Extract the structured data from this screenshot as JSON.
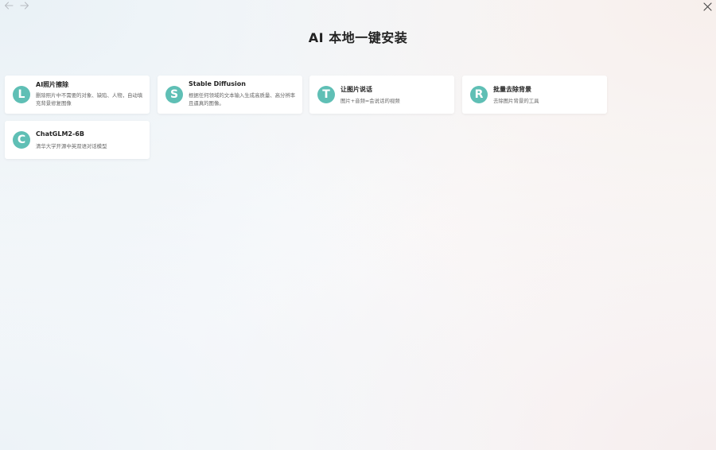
{
  "nav": {
    "back_icon": "arrow-left-icon",
    "forward_icon": "arrow-right-icon",
    "close_icon": "close-icon"
  },
  "page": {
    "title": "AI 本地一键安装"
  },
  "colors": {
    "accent": "#5fbfb5"
  },
  "apps": [
    {
      "letter": "L",
      "title": "AI照片擦除",
      "description": "删除照片中不需要的对象、缺陷、人物，自动填充背景修复图像"
    },
    {
      "letter": "S",
      "title": "Stable Diffusion",
      "description": "根据任何领域的文本输入生成高质量、高分辨率且逼真的图像。"
    },
    {
      "letter": "T",
      "title": "让图片说话",
      "description": "图片+音频=会说话的视频"
    },
    {
      "letter": "R",
      "title": "批量去除背景",
      "description": "去除图片背景的工具"
    },
    {
      "letter": "C",
      "title": "ChatGLM2-6B",
      "description": "清华大学开源中英双语对话模型"
    }
  ]
}
